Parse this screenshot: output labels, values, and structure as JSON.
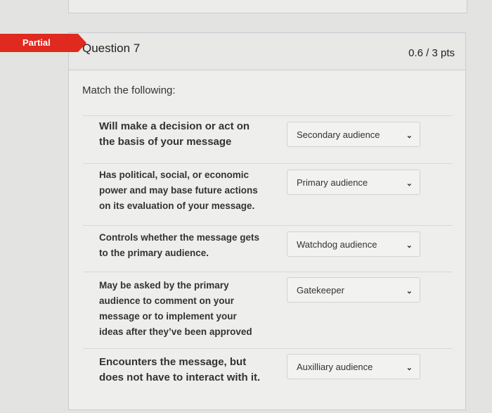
{
  "question": {
    "badge": "Partial",
    "title": "Question 7",
    "points": "0.6 / 3 pts",
    "prompt": "Match the following:"
  },
  "matches": [
    {
      "text": "Will make a decision or act on the basis of your message",
      "selected": "Secondary audience"
    },
    {
      "text": "Has political, social, or economic power and may base future actions on its evaluation of your message.",
      "selected": "Primary audience"
    },
    {
      "text": "Controls whether the message gets to the primary audience.",
      "selected": "Watchdog audience"
    },
    {
      "text": "May be asked by the primary audience to comment on your message or to implement your ideas after they’ve been approved",
      "selected": "Gatekeeper"
    },
    {
      "text": "Encounters the message, but does not have to interact with it.",
      "selected": "Auxilliary audience"
    }
  ],
  "icons": {
    "dropdown": "chevron-down-icon"
  }
}
